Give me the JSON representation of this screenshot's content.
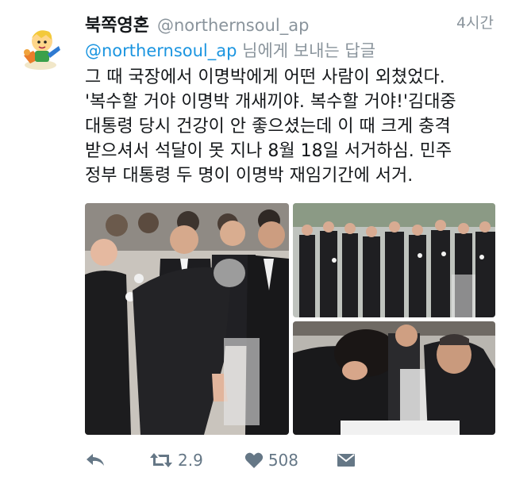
{
  "tweet": {
    "display_name": "북쪽영혼",
    "handle": "@northernsoul_ap",
    "time": "4시간",
    "reply_to_handle": "@northernsoul_ap",
    "reply_to_suffix": " 님에게 보내는 답글",
    "text_lines": [
      "그 때 국장에서 이명박에게 어떤 사람이 외쳤었다.",
      "'복수할 거야 이명박 개새끼야. 복수할 거야!'김대중",
      "대통령 당시 건강이 안 좋으셨는데 이 때 크게 충격",
      "받으셔서 석달이 못 지나 8월 18일 서거하심. 민주",
      "정부 대통령 두 명이 이명박 재임기간에 서거."
    ]
  },
  "actions": {
    "retweets": "2.9",
    "likes": "508"
  },
  "colors": {
    "link": "#1b95e0",
    "muted": "#8a949c",
    "action": "#657786"
  },
  "icons": [
    "avatar-cartoon",
    "reply-icon",
    "retweet-icon",
    "heart-icon",
    "message-icon"
  ]
}
